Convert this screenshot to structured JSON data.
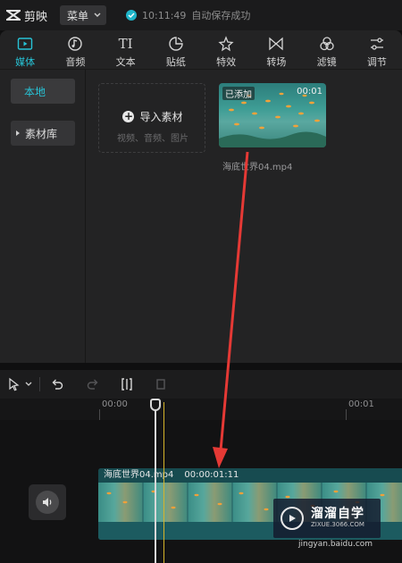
{
  "app": {
    "title": "剪映"
  },
  "menu": {
    "label": "菜单"
  },
  "status": {
    "time": "10:11:49",
    "text": "自动保存成功"
  },
  "toolbar": {
    "items": [
      {
        "label": "媒体",
        "icon": "media-icon",
        "active": true
      },
      {
        "label": "音频",
        "icon": "audio-icon"
      },
      {
        "label": "文本",
        "icon": "text-icon",
        "glyph": "TI"
      },
      {
        "label": "贴纸",
        "icon": "sticker-icon"
      },
      {
        "label": "特效",
        "icon": "effects-icon"
      },
      {
        "label": "转场",
        "icon": "transition-icon"
      },
      {
        "label": "滤镜",
        "icon": "filter-icon"
      },
      {
        "label": "调节",
        "icon": "adjust-icon"
      }
    ]
  },
  "sidebar": {
    "local": "本地",
    "library": "素材库"
  },
  "import": {
    "label": "导入素材",
    "sub": "视频、音频、图片"
  },
  "media": {
    "badge": "已添加",
    "duration": "00:01",
    "name": "海底世界04.mp4"
  },
  "ruler": {
    "start": "00:00",
    "end": "00:01"
  },
  "clip": {
    "name": "海底世界04.mp4",
    "duration": "00:00:01:11"
  },
  "watermark": {
    "title": "溜溜自学",
    "sub": "ZIXUE.3066.COM",
    "url": "jingyan.baidu.com"
  },
  "colors": {
    "accent": "#27c3d6",
    "arrow": "#e53935",
    "clip": "#1f6166"
  }
}
